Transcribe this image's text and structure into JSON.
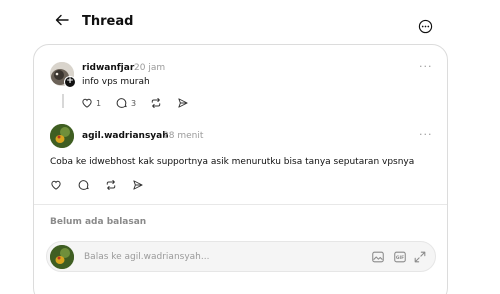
{
  "header": {
    "title": "Thread"
  },
  "post": {
    "username": "ridwanfjar",
    "time": "20 jam",
    "text": "info vps murah",
    "likes": "1",
    "replies": "3"
  },
  "reply": {
    "username": "agil.wadriansyah",
    "time": "28 menit",
    "text": "Coba ke idwebhost kak supportnya asik menurutku bisa tanya seputaran vpsnya"
  },
  "status": {
    "no_replies": "Belum ada balasan"
  },
  "composer": {
    "placeholder": "Balas ke agil.wadriansyah..."
  },
  "icons": {
    "back": "arrow-left-icon",
    "more": "more-circle-icon",
    "like": "heart-icon",
    "comment": "comment-icon",
    "repost": "repost-icon",
    "share": "send-icon",
    "image": "image-icon",
    "gif": "gif-icon",
    "expand": "expand-icon"
  }
}
